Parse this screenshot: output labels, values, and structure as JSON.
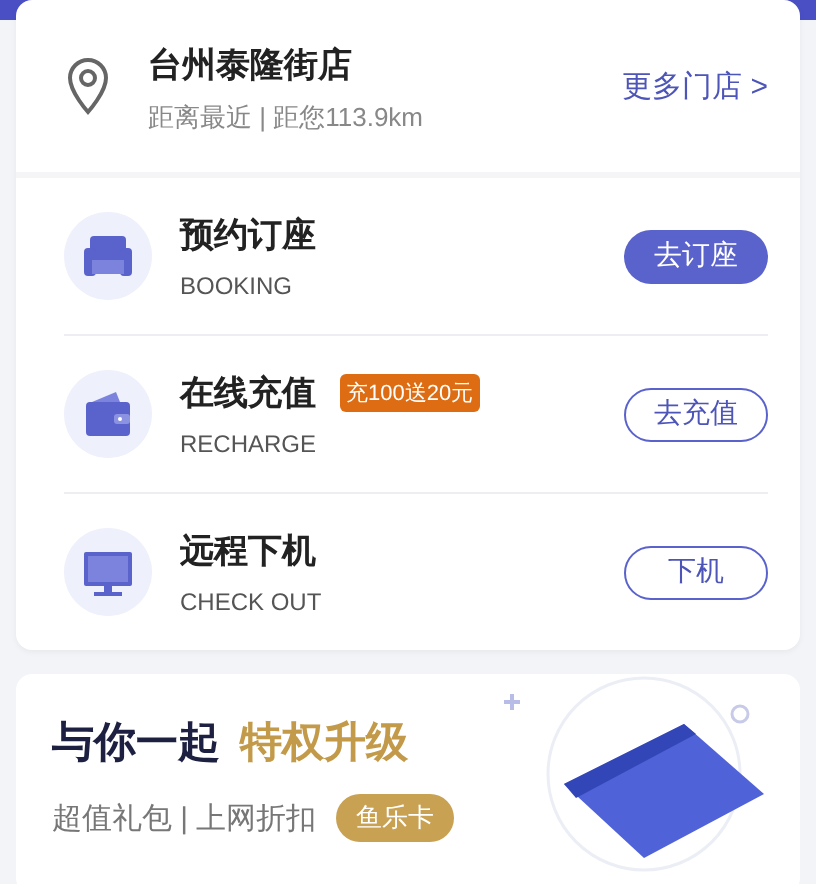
{
  "store": {
    "name": "台州泰隆街店",
    "distance": "距离最近 | 距您113.9km",
    "more_link": "更多门店 >"
  },
  "services": [
    {
      "kind": "booking",
      "title": "预约订座",
      "subtitle": "BOOKING",
      "button": {
        "label": "去订座",
        "kind": "filled"
      }
    },
    {
      "kind": "recharge",
      "title": "在线充值",
      "badge": "充100送20元",
      "subtitle": "RECHARGE",
      "button": {
        "label": "去充值",
        "kind": "outline"
      }
    },
    {
      "kind": "checkout",
      "title": "远程下机",
      "subtitle": "CHECK OUT",
      "button": {
        "label": "下机",
        "kind": "outline"
      }
    }
  ],
  "promo": {
    "title": "与你一起",
    "highlight": "特权升级",
    "subtitle": "超值礼包 | 上网折扣",
    "tag": "鱼乐卡"
  }
}
